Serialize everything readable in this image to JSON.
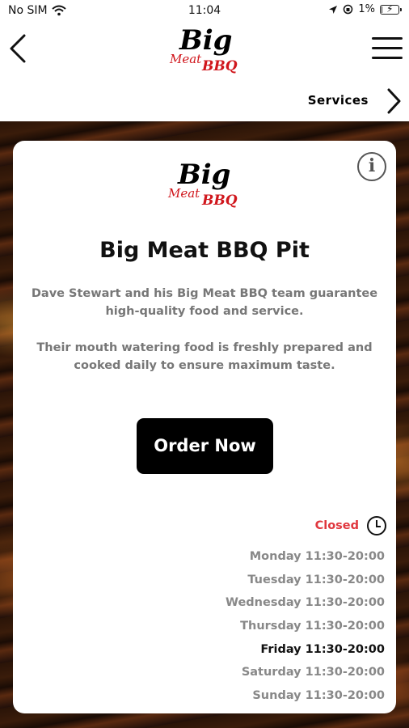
{
  "status_bar": {
    "carrier": "No SIM",
    "time": "11:04",
    "battery_percent": "1%",
    "battery_level": 0.01
  },
  "header": {
    "logo": {
      "big": "Big",
      "meat": "Meat",
      "bbq": "BBQ"
    },
    "back_icon": "chevron-left-icon",
    "menu_icon": "hamburger-menu-icon"
  },
  "nav": {
    "services_label": "Services"
  },
  "card": {
    "logo": {
      "big": "Big",
      "meat": "Meat",
      "bbq": "BBQ"
    },
    "info_icon": "i",
    "title": "Big Meat BBQ Pit",
    "paragraph1": "Dave Stewart and his Big Meat BBQ team guarantee high-quality food and service.",
    "paragraph2": "Their mouth watering food is freshly prepared and cooked daily to ensure maximum taste.",
    "order_label": "Order Now",
    "status_text": "Closed",
    "hours": [
      {
        "text": "Monday 11:30-20:00",
        "today": false
      },
      {
        "text": "Tuesday 11:30-20:00",
        "today": false
      },
      {
        "text": "Wednesday 11:30-20:00",
        "today": false
      },
      {
        "text": "Thursday 11:30-20:00",
        "today": false
      },
      {
        "text": "Friday 11:30-20:00",
        "today": true
      },
      {
        "text": "Saturday 11:30-20:00",
        "today": false
      },
      {
        "text": "Sunday 11:30-20:00",
        "today": false
      }
    ]
  },
  "colors": {
    "accent_red": "#d0161c",
    "closed_red": "#e0373e",
    "button_bg": "#000000"
  }
}
